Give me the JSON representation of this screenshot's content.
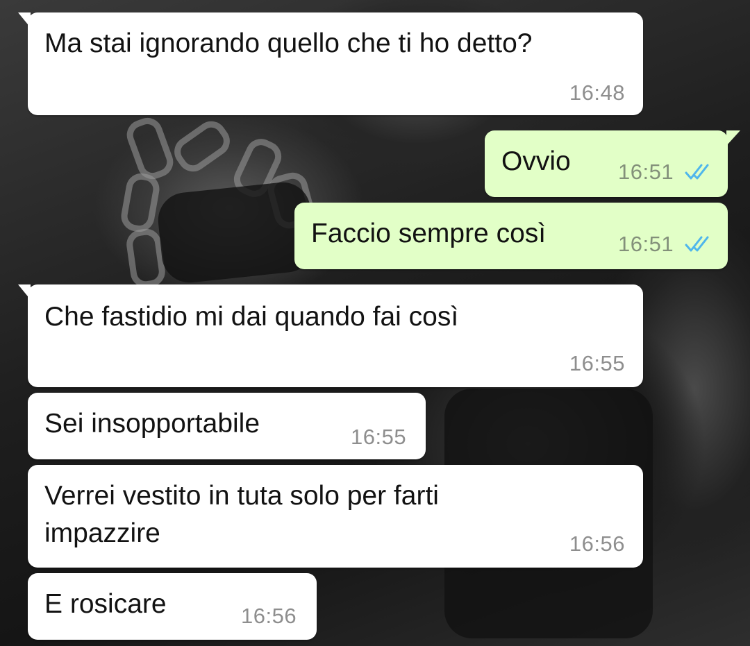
{
  "messages": [
    {
      "direction": "incoming",
      "text": "Ma stai ignorando quello che ti ho detto?",
      "time": "16:48"
    },
    {
      "direction": "outgoing",
      "text": "Ovvio",
      "time": "16:51",
      "status": "read"
    },
    {
      "direction": "outgoing",
      "text": "Faccio sempre così",
      "time": "16:51",
      "status": "read"
    },
    {
      "direction": "incoming",
      "text": "Che fastidio mi dai quando fai così",
      "time": "16:55"
    },
    {
      "direction": "incoming",
      "text": "Sei insopportabile",
      "time": "16:55"
    },
    {
      "direction": "incoming",
      "text": "Verrei vestito in tuta solo per farti\nimpazzire",
      "time": "16:56"
    },
    {
      "direction": "incoming",
      "text": "E rosicare",
      "time": "16:56"
    }
  ],
  "colors": {
    "incoming_bubble": "#ffffff",
    "outgoing_bubble": "#e2ffc7",
    "read_ticks": "#4fb6ec",
    "timestamp": "#8e8e8e"
  },
  "icons": {
    "read_status": "double-check-icon"
  }
}
